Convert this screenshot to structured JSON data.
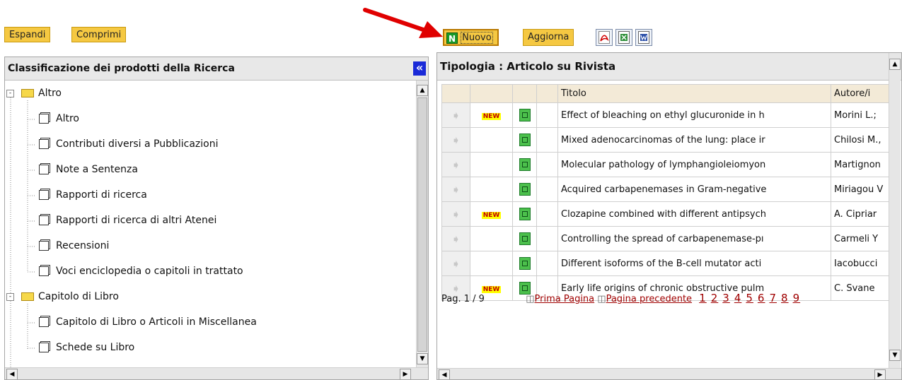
{
  "toolbar_left": {
    "expand": "Espandi",
    "collapse": "Comprimi"
  },
  "toolbar_right": {
    "new": "Nuovo",
    "refresh": "Aggiorna"
  },
  "left_panel": {
    "title": "Classificazione dei prodotti della Ricerca",
    "collapse_glyph": "«",
    "tree": [
      {
        "label": "Altro",
        "type": "folder"
      },
      {
        "label": "Altro",
        "type": "leaf"
      },
      {
        "label": "Contributi diversi a Pubblicazioni",
        "type": "leaf"
      },
      {
        "label": "Note a Sentenza",
        "type": "leaf"
      },
      {
        "label": "Rapporti di ricerca",
        "type": "leaf"
      },
      {
        "label": "Rapporti di ricerca di altri Atenei",
        "type": "leaf"
      },
      {
        "label": "Recensioni",
        "type": "leaf"
      },
      {
        "label": "Voci enciclopedia o capitoli in trattato",
        "type": "leaf"
      },
      {
        "label": "Capitolo di Libro",
        "type": "folder"
      },
      {
        "label": "Capitolo di Libro o Articoli in Miscellanea",
        "type": "leaf"
      },
      {
        "label": "Schede su Libro",
        "type": "leaf"
      }
    ]
  },
  "right_panel": {
    "title": "Tipologia : Articolo su Rivista",
    "columns": {
      "title": "Titolo",
      "authors": "Autore/i"
    },
    "new_badge": "NEW",
    "rows": [
      {
        "is_new": true,
        "title": "Effect of bleaching on ethyl glucuronide in h",
        "authors": "Morini L.;"
      },
      {
        "is_new": false,
        "title": "Mixed adenocarcinomas of the lung: place ir",
        "authors": "Chilosi M.,"
      },
      {
        "is_new": false,
        "title": "Molecular pathology of lymphangioleiomyon",
        "authors": "Martignon"
      },
      {
        "is_new": false,
        "title": "Acquired carbapenemases in Gram-negative",
        "authors": "Miriagou V"
      },
      {
        "is_new": true,
        "title": "Clozapine combined with different antipsych",
        "authors": "A. Cipriar"
      },
      {
        "is_new": false,
        "title": "Controlling the spread of carbapenemase-pı",
        "authors": "Carmeli Y"
      },
      {
        "is_new": false,
        "title": "Different isoforms of the B-cell mutator acti",
        "authors": "Iacobucci"
      },
      {
        "is_new": true,
        "title": "Early life origins of chronic obstructive pulm",
        "authors": "C. Svane"
      }
    ],
    "pager": {
      "label": "Pag. 1 / 9",
      "first": "Prima Pagina",
      "prev": "Pagina precedente",
      "pages": [
        "1",
        "2",
        "3",
        "4",
        "5",
        "6",
        "7",
        "8",
        "9"
      ]
    }
  },
  "colors": {
    "button_bg": "#f5c842",
    "arrow": "#e00000",
    "link": "#a00000",
    "badge": "#ffff00"
  }
}
